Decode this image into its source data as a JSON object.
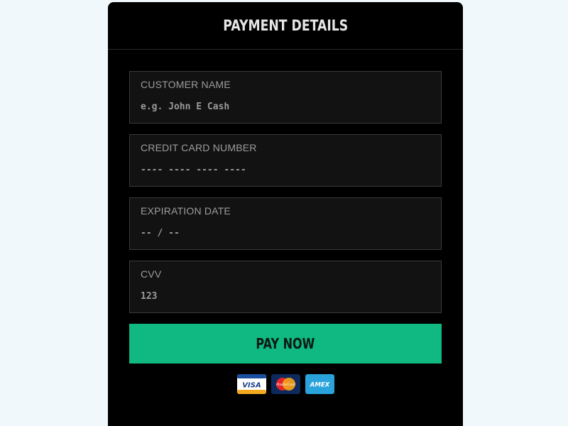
{
  "header": {
    "title": "PAYMENT DETAILS"
  },
  "form": {
    "customer_name": {
      "label": "CUSTOMER NAME",
      "value": "",
      "placeholder": "e.g. John E Cash"
    },
    "card_number": {
      "label": "CREDIT CARD NUMBER",
      "value": "",
      "placeholder": "---- ---- ---- ----"
    },
    "expiration": {
      "label": "EXPIRATION DATE",
      "value": "",
      "placeholder": "-- / --"
    },
    "cvv": {
      "label": "CVV",
      "value": "",
      "placeholder": "123"
    }
  },
  "pay_button": {
    "label": "PAY NOW",
    "color": "#10b981"
  },
  "accepted_cards": {
    "visa": "VISA",
    "mastercard": "MasterCard",
    "amex": "AMEX"
  },
  "colors": {
    "page_background": "#f0f8fb",
    "card_background": "#000000",
    "field_background": "#121212",
    "accent": "#10b981"
  }
}
